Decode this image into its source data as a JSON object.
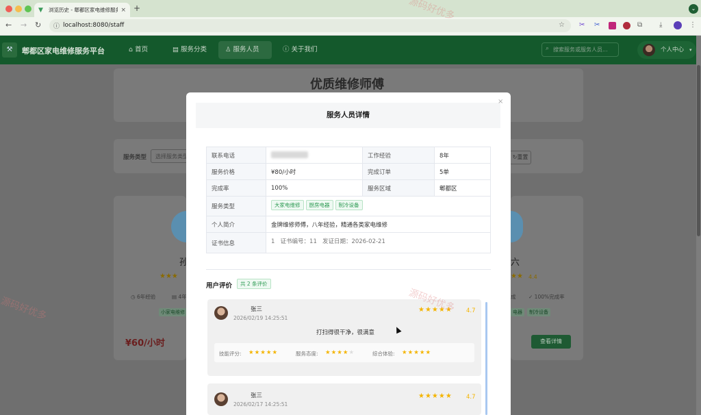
{
  "browser": {
    "tab_title": "浏览历史 - 郫都区家电维修服务",
    "tab_close": "×",
    "new_tab": "+",
    "url": "localhost:8080/staff"
  },
  "header": {
    "brand": "郫都区家电维修服务平台",
    "nav": [
      {
        "label": "首页",
        "icon": "home-icon"
      },
      {
        "label": "服务分类",
        "icon": "category-icon"
      },
      {
        "label": "服务人员",
        "icon": "user-icon"
      },
      {
        "label": "关于我们",
        "icon": "info-icon"
      }
    ],
    "search_placeholder": "搜索服务或服务人员...",
    "user_menu": "个人中心"
  },
  "background": {
    "page_title": "优质维修师傅",
    "filter_label": "服务类型",
    "filter_placeholder": "选择服务类型",
    "reset_button": "重置",
    "left_card": {
      "name": "孙",
      "exp": "6年经验",
      "orders": "4年",
      "tag": "小家电维修",
      "price": "¥60/小时"
    },
    "right_card": {
      "name": "六",
      "rating": "4.4",
      "rate": "100%完成率",
      "tag1": "电器",
      "tag2": "制冷设备",
      "detail_button": "查看详情"
    }
  },
  "modal": {
    "title": "服务人员详情",
    "close": "×",
    "info": {
      "phone_label": "联系电话",
      "experience_label": "工作经验",
      "experience": "8年",
      "price_label": "服务价格",
      "price": "¥80/小时",
      "orders_label": "完成订单",
      "orders": "5单",
      "rate_label": "完成率",
      "rate": "100%",
      "area_label": "服务区域",
      "area": "郫都区",
      "type_label": "服务类型",
      "types": [
        "大家电维修",
        "厨房电器",
        "制冷设备"
      ],
      "intro_label": "个人简介",
      "intro": "金牌维修师傅，八年经验，精通各类家电维修",
      "cert_label": "证书信息",
      "cert_index": "1",
      "cert_no": "证书编号：11",
      "cert_date": "发证日期：2026-02-21"
    },
    "reviews_title": "用户评价",
    "reviews_count": "共 2 条评价",
    "reviews": [
      {
        "name": "张三",
        "time": "2026/02/19 14:25:51",
        "score": "4.7",
        "content": "打扫得很干净，很满意",
        "skill_label": "技能评分:",
        "attitude_label": "服务态度:",
        "overall_label": "综合体验:"
      },
      {
        "name": "张三",
        "time": "2026/02/17 14:25:51",
        "score": "4.7"
      }
    ]
  },
  "watermark": "源码好优多"
}
